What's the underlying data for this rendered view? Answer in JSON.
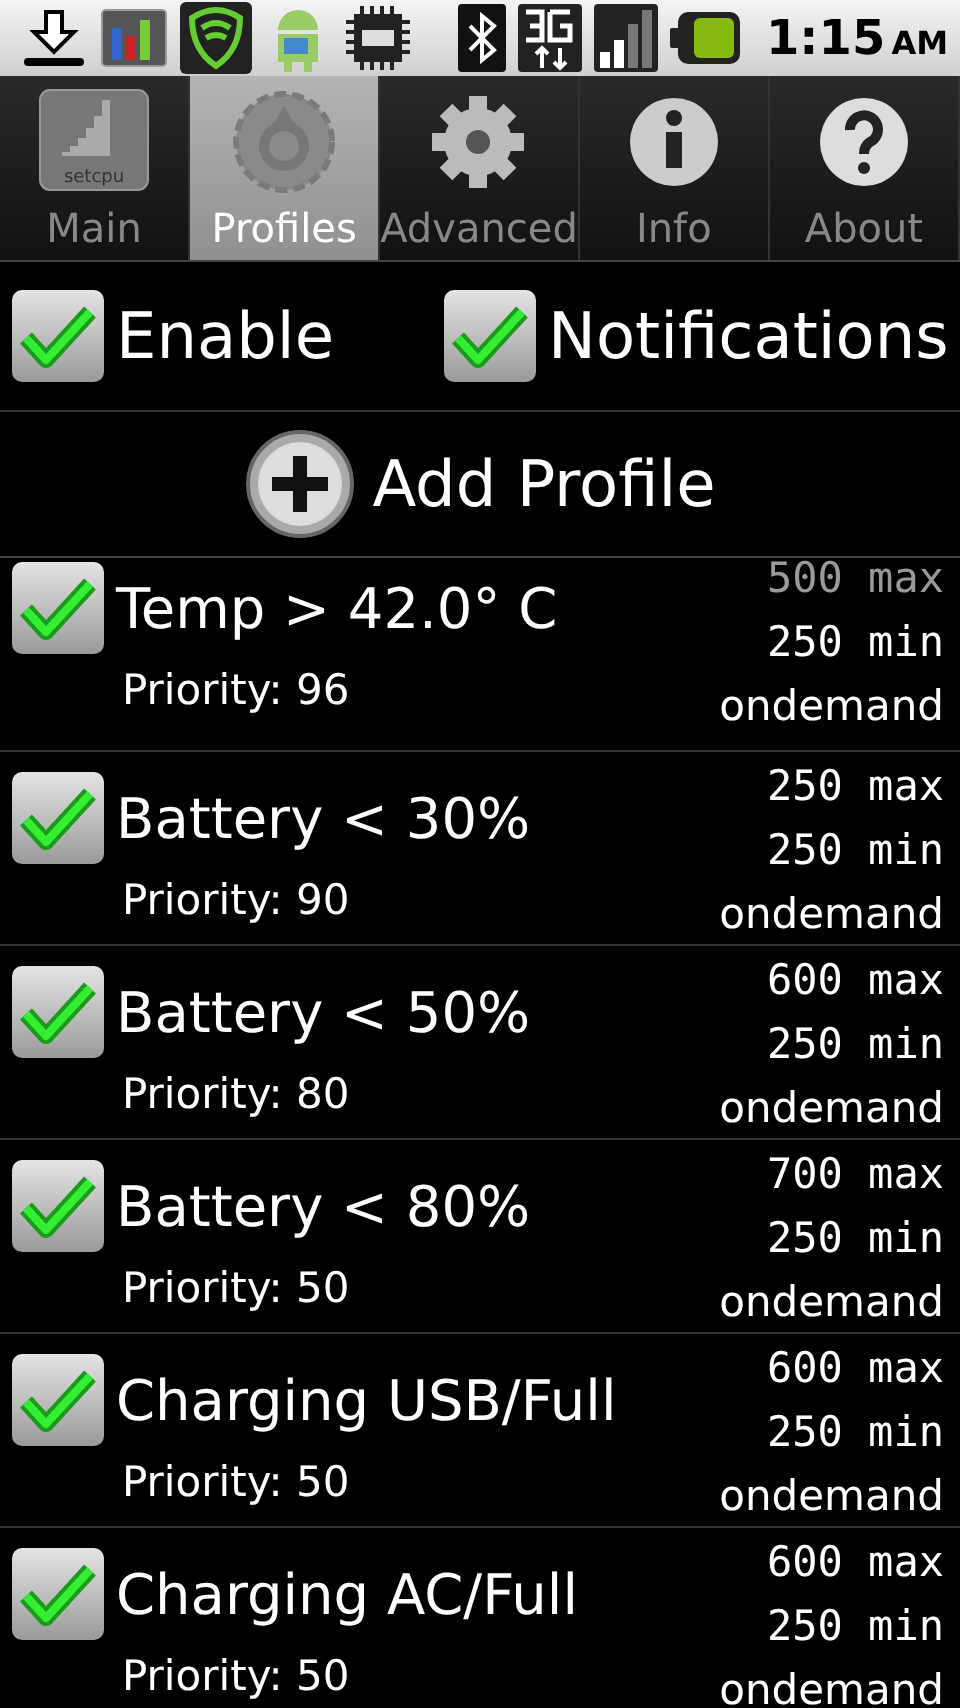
{
  "status_bar": {
    "time": "1:15",
    "meridiem": "AM"
  },
  "tabs": [
    {
      "label": "Main",
      "kind": "logo",
      "icon_text": "setcpu",
      "selected": false
    },
    {
      "label": "Profiles",
      "kind": "dial",
      "selected": true
    },
    {
      "label": "Advanced",
      "kind": "gear",
      "selected": false
    },
    {
      "label": "Info",
      "kind": "info",
      "selected": false
    },
    {
      "label": "About",
      "kind": "help",
      "selected": false
    }
  ],
  "toggles": [
    {
      "label": "Enable",
      "checked": true
    },
    {
      "label": "Notifications",
      "checked": true
    }
  ],
  "add_profile": {
    "label": "Add Profile"
  },
  "profiles": [
    {
      "name": "Temp > 42.0° C",
      "priority": "Priority: 96",
      "max": "500 max",
      "min": "250 min",
      "governor": "ondemand",
      "enabled": true
    },
    {
      "name": "Battery < 30%",
      "priority": "Priority: 90",
      "max": "250 max",
      "min": "250 min",
      "governor": "ondemand",
      "enabled": true
    },
    {
      "name": "Battery < 50%",
      "priority": "Priority: 80",
      "max": "600 max",
      "min": "250 min",
      "governor": "ondemand",
      "enabled": true
    },
    {
      "name": "Battery < 80%",
      "priority": "Priority: 50",
      "max": "700 max",
      "min": "250 min",
      "governor": "ondemand",
      "enabled": true
    },
    {
      "name": "Charging USB/Full",
      "priority": "Priority: 50",
      "max": "600 max",
      "min": "250 min",
      "governor": "ondemand",
      "enabled": true
    },
    {
      "name": "Charging AC/Full",
      "priority": "Priority: 50",
      "max": "600 max",
      "min": "250 min",
      "governor": "ondemand",
      "enabled": true
    }
  ]
}
